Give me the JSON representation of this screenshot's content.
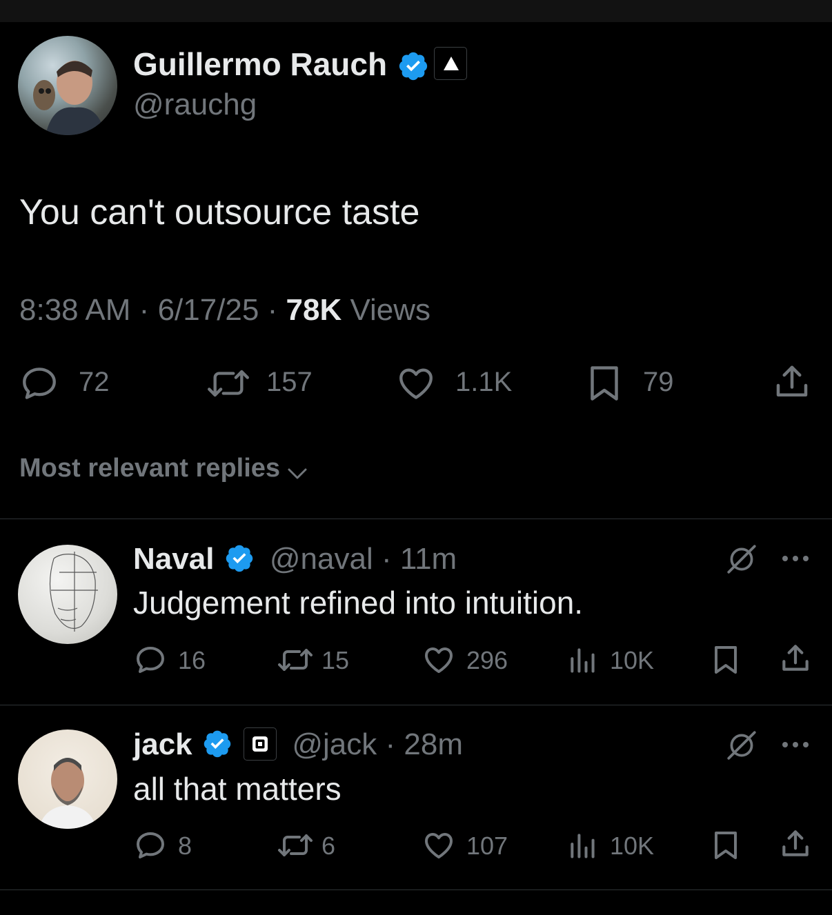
{
  "main_tweet": {
    "author_name": "Guillermo Rauch",
    "handle": "@rauchg",
    "text": "You can't outsource taste",
    "time": "8:38 AM",
    "sep1": "·",
    "date": "6/17/25",
    "sep2": "·",
    "views_count": "78K",
    "views_label": "Views",
    "replies": "72",
    "reposts": "157",
    "likes": "1.1K",
    "bookmarks": "79"
  },
  "sort": {
    "label": "Most relevant replies"
  },
  "replies": [
    {
      "name": "Naval",
      "handle": "@naval",
      "sep": "·",
      "time": "11m",
      "text": "Judgement refined into intuition.",
      "replies": "16",
      "reposts": "15",
      "likes": "296",
      "views": "10K"
    },
    {
      "name": "jack",
      "handle": "@jack",
      "sep": "·",
      "time": "28m",
      "text": "all that matters",
      "replies": "8",
      "reposts": "6",
      "likes": "107",
      "views": "10K"
    }
  ],
  "colors": {
    "background": "#000000",
    "text": "#e7e9ea",
    "muted": "#71767b",
    "verified": "#1d9bf0",
    "divider": "#2f3336"
  }
}
